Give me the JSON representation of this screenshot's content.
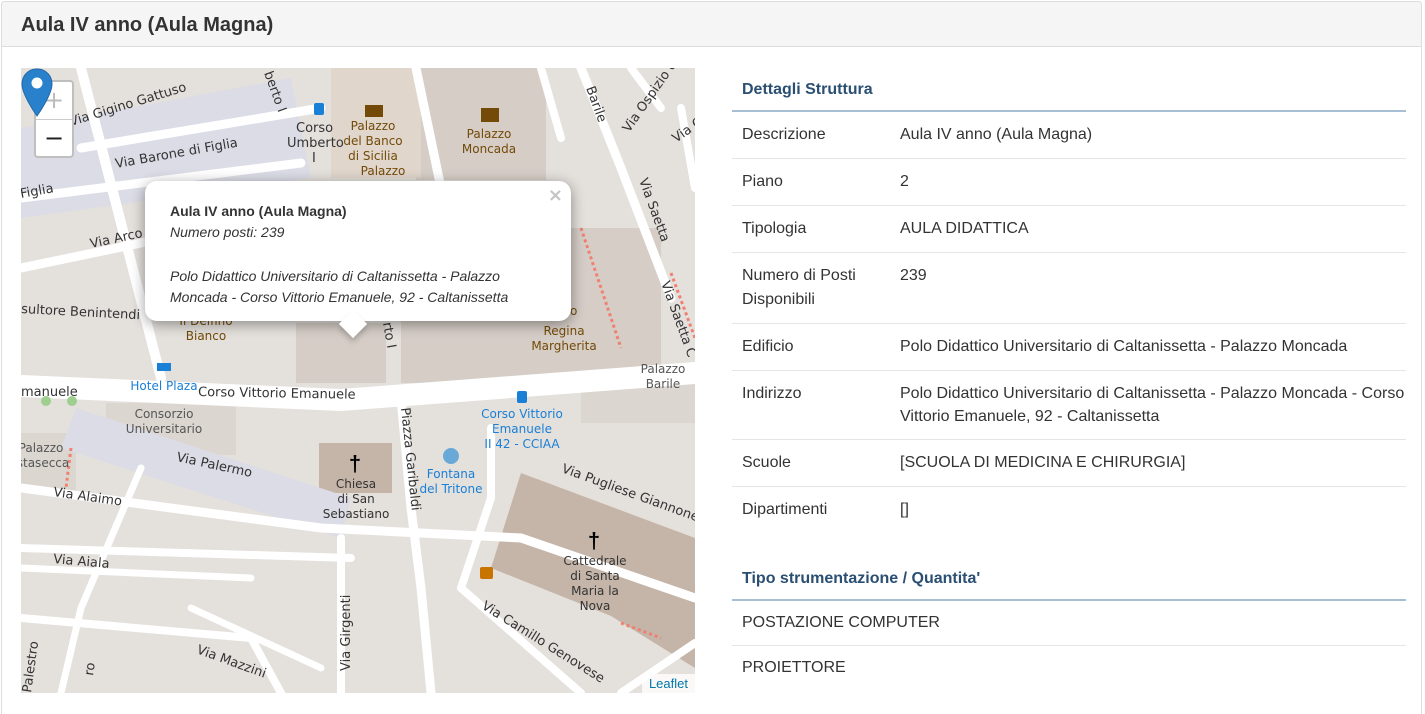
{
  "page": {
    "title": "Aula IV anno (Aula Magna)"
  },
  "map": {
    "zoom_in": "+",
    "zoom_out": "−",
    "attribution": "Leaflet",
    "popup": {
      "close": "×",
      "name": "Aula IV anno (Aula Magna)",
      "seats": "Numero posti: 239",
      "address": "Polo Didattico Universitario di Caltanissetta - Palazzo Moncada - Corso Vittorio Emanuele, 92 - Caltanissetta"
    },
    "labels": {
      "via_gigino_gattuso": "Via Gigino Gattuso",
      "via_barone_di_figlia": "Via Barone di Figlia",
      "figlia": "Figlia",
      "via_arco": "Via Arco",
      "umberto_i": "berto I",
      "corso_umberto_1": "Corso",
      "corso_umberto_2": "Umberto",
      "corso_umberto_3": "I",
      "palazzo_banco_1": "Palazzo",
      "palazzo_banco_2": "del Banco",
      "palazzo_banco_3": "di Sicilia",
      "palazzo_banco_4": "Palazzo",
      "palazzo_moncada_1": "Palazzo",
      "palazzo_moncada_2": "Moncada",
      "barile": "Barile",
      "via_ospizio": "Via Ospizio d",
      "via_gia": "Via Gia",
      "via_saetta": "Via Saetta",
      "via_saetta_c": "Via Saetta C",
      "sultore": "sultore Benintendi",
      "delfino_1": "Il Delfino",
      "delfino_2": "Bianco",
      "regina_1": "tro",
      "regina_2": "Regina",
      "regina_3": "Margherita",
      "hotel_plaza": "Hotel Plaza",
      "emanuele": "manuele",
      "corso_vittorio": "Corso Vittorio Emanuele",
      "palazzo_barile_1": "Palazzo",
      "palazzo_barile_2": "Barile",
      "consorzio_1": "Consorzio",
      "consorzio_2": "Universitario",
      "palazzo_st_1": "Palazzo",
      "palazzo_st_2": "stasecca",
      "via_palermo": "Via Palermo",
      "via_alaimo": "Via Alaimo",
      "chiesa_1": "Chiesa",
      "chiesa_2": "di San",
      "chiesa_3": "Sebastiano",
      "piazza_garibaldi": "Piazza Garibaldi",
      "fontana_1": "Fontana",
      "fontana_2": "del Tritone",
      "bus_cv_1": "Corso Vittorio",
      "bus_cv_2": "Emanuele",
      "bus_cv_3": "II 42 - CCIAA",
      "via_pugliese": "Via Pugliese Giannone",
      "cattedrale_1": "Cattedrale",
      "cattedrale_2": "di Santa",
      "cattedrale_3": "Maria la",
      "cattedrale_4": "Nova",
      "via_aiala": "Via Aiala",
      "via_girgenti": "Via Girgenti",
      "via_mazzini": "Via Mazzini",
      "via_camillo": "Via Camillo Genovese",
      "palestro": "Palestro",
      "rto_i": "rto I",
      "ro": "ro"
    }
  },
  "details": {
    "header": "Dettagli Struttura",
    "rows": [
      {
        "key": "Descrizione",
        "value": "Aula IV anno (Aula Magna)"
      },
      {
        "key": "Piano",
        "value": "2"
      },
      {
        "key": "Tipologia",
        "value": "AULA DIDATTICA"
      },
      {
        "key": "Numero di Posti Disponibili",
        "value": "239"
      },
      {
        "key": "Edificio",
        "value": "Polo Didattico Universitario di Caltanissetta - Palazzo Moncada"
      },
      {
        "key": "Indirizzo",
        "value": "Polo Didattico Universitario di Caltanissetta - Palazzo Moncada - Corso Vittorio Emanuele, 92 - Caltanissetta"
      },
      {
        "key": "Scuole",
        "value": "[SCUOLA DI MEDICINA E CHIRURGIA]"
      },
      {
        "key": "Dipartimenti",
        "value": "[]"
      }
    ]
  },
  "strumentazione": {
    "header": "Tipo strumentazione / Quantita'",
    "items": [
      "POSTAZIONE COMPUTER",
      "PROIETTORE"
    ]
  },
  "colors": {
    "heading_blue": "#2a4f72",
    "marker": "#2a81cb",
    "link": "#0078a8"
  }
}
